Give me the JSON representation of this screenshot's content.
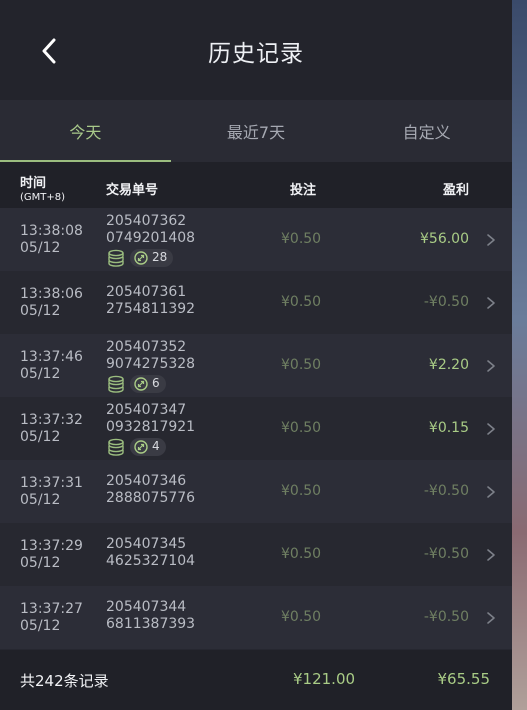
{
  "header": {
    "title": "历史记录"
  },
  "tabs": [
    {
      "label": "今天",
      "active": true
    },
    {
      "label": "最近7天",
      "active": false
    },
    {
      "label": "自定义",
      "active": false
    }
  ],
  "columns": {
    "time": "时间",
    "time_sub": "(GMT+8)",
    "order": "交易单号",
    "bet": "投注",
    "profit": "盈利"
  },
  "rows": [
    {
      "time": "13:38:08",
      "date": "05/12",
      "order1": "205407362",
      "order2": "0749201408",
      "bet": "¥0.50",
      "profit": "¥56.00",
      "positive": true,
      "badge_count": "28"
    },
    {
      "time": "13:38:06",
      "date": "05/12",
      "order1": "205407361",
      "order2": "2754811392",
      "bet": "¥0.50",
      "profit": "-¥0.50",
      "positive": false,
      "badge_count": null
    },
    {
      "time": "13:37:46",
      "date": "05/12",
      "order1": "205407352",
      "order2": "9074275328",
      "bet": "¥0.50",
      "profit": "¥2.20",
      "positive": true,
      "badge_count": "6"
    },
    {
      "time": "13:37:32",
      "date": "05/12",
      "order1": "205407347",
      "order2": "0932817921",
      "bet": "¥0.50",
      "profit": "¥0.15",
      "positive": true,
      "badge_count": "4"
    },
    {
      "time": "13:37:31",
      "date": "05/12",
      "order1": "205407346",
      "order2": "2888075776",
      "bet": "¥0.50",
      "profit": "-¥0.50",
      "positive": false,
      "badge_count": null
    },
    {
      "time": "13:37:29",
      "date": "05/12",
      "order1": "205407345",
      "order2": "4625327104",
      "bet": "¥0.50",
      "profit": "-¥0.50",
      "positive": false,
      "badge_count": null
    },
    {
      "time": "13:37:27",
      "date": "05/12",
      "order1": "205407344",
      "order2": "6811387393",
      "bet": "¥0.50",
      "profit": "-¥0.50",
      "positive": false,
      "badge_count": null
    }
  ],
  "footer": {
    "total_label": "共242条记录",
    "total_bet": "¥121.00",
    "total_profit": "¥65.55"
  },
  "colors": {
    "accent": "#a9cc86",
    "muted_green": "#6f7f62",
    "background": "#262730"
  },
  "icons": {
    "back": "chevron-left-icon",
    "row": "chevron-right-icon",
    "coins": "coins-icon",
    "feature": "feature-badge-icon"
  }
}
